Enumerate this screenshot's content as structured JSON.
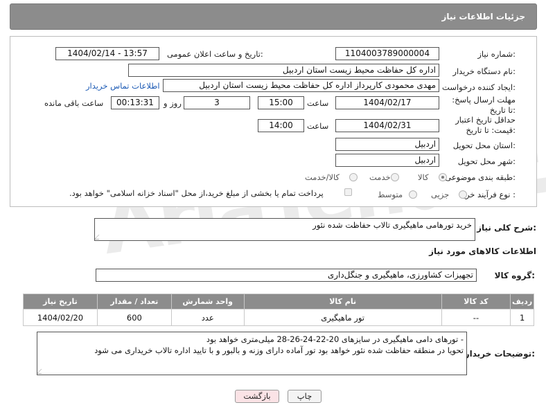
{
  "header": {
    "title": "جزئیات اطلاعات نیاز"
  },
  "form": {
    "need_number": {
      "label": "شماره نیاز:",
      "value": "1104003789000004"
    },
    "announce": {
      "label": "تاریخ و ساعت اعلان عمومی:",
      "value": "1404/02/14 - 13:57"
    },
    "buyer_org": {
      "label": "نام دستگاه خریدار:",
      "value": "اداره کل حفاظت محیط زیست استان اردبیل"
    },
    "creator": {
      "label": "ایجاد کننده درخواست:",
      "value": "مهدی محمودی کارپرداز اداره کل حفاظت محیط زیست استان اردبیل",
      "contact_link": "اطلاعات تماس خریدار"
    },
    "deadline": {
      "label": "مهلت ارسال پاسخ: تا تاریخ:",
      "date": "1404/02/17",
      "time_label": "ساعت",
      "time": "15:00",
      "days": "3",
      "days_label": "روز و",
      "remaining": "00:13:31",
      "remaining_label": "ساعت باقی مانده"
    },
    "validity": {
      "label": "حداقل تاریخ اعتبار قیمت: تا تاریخ:",
      "date": "1404/02/31",
      "time_label": "ساعت",
      "time": "14:00"
    },
    "delivery_province": {
      "label": "استان محل تحویل:",
      "value": "اردبیل"
    },
    "delivery_city": {
      "label": "شهر محل تحویل:",
      "value": "اردبیل"
    },
    "category": {
      "label": "طبقه بندی موضوعی:",
      "options": [
        "کالا",
        "خدمت",
        "کالا/خدمت"
      ],
      "selected": "کالا"
    },
    "process": {
      "label": "نوع فرآیند خرید :",
      "options": [
        "جزیی",
        "متوسط"
      ],
      "note": "پرداخت تمام یا بخشی از مبلغ خرید،از محل \"اسناد خزانه اسلامی\" خواهد بود."
    }
  },
  "description": {
    "label": "شرح کلی نیاز:",
    "value": "خرید تورهامی ماهیگیری تالاب حفاظت شده نئور"
  },
  "goods_info_title": "اطلاعات کالاهای مورد نیاز",
  "goods_group": {
    "label": "گروه کالا:",
    "value": "تجهیزات کشاورزی، ماهیگیری و جنگل‌داری"
  },
  "table": {
    "headers": [
      "ردیف",
      "کد کالا",
      "نام کالا",
      "واحد شمارش",
      "تعداد / مقدار",
      "تاریخ نیاز"
    ],
    "rows": [
      [
        "1",
        "--",
        "تور ماهیگیری",
        "عدد",
        "600",
        "1404/02/20"
      ]
    ]
  },
  "buyer_notes": {
    "label": "توضیحات خریدار:",
    "line1": "-      تورهای دامی ماهیگیری در سایزهای 20-22-24-26-28 میلی‌متری خواهد بود",
    "line2": "تحویا در منطقه حفاظت شده نئور خواهد بود تور آماده دارای وزنه و بالبور و با تایید اداره تالاب خریداری می شود"
  },
  "buttons": {
    "print": "چاپ",
    "back": "بازگشت"
  },
  "watermark": "AriaTender.neT",
  "colors": {
    "header_bg": "#8c8c8c",
    "link": "#1d5bb5",
    "back_bg": "#fbe3e6"
  }
}
